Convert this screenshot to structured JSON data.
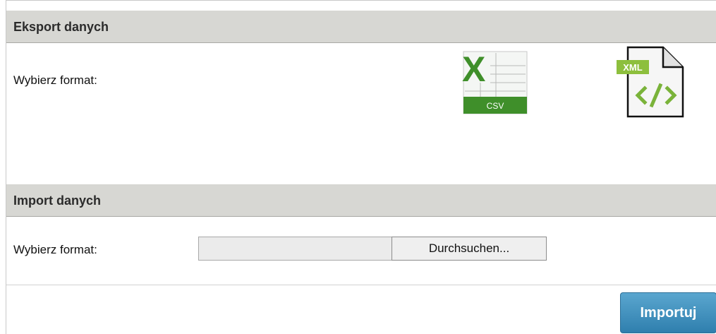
{
  "export": {
    "header": "Eksport danych",
    "label": "Wybierz format:",
    "formats": [
      {
        "name": "CSV",
        "icon": "csv-file-icon",
        "badge": "CSV"
      },
      {
        "name": "XML",
        "icon": "xml-file-icon",
        "badge": "XML"
      }
    ]
  },
  "import": {
    "header": "Import danych",
    "label": "Wybierz format:",
    "file_input": {
      "value": "",
      "browse_label": "Durchsuchen..."
    },
    "submit_label": "Importuj"
  },
  "colors": {
    "header_bg": "#d7d7d3",
    "button_blue": "#3a8cba",
    "excel_green": "#3f8f2a",
    "xml_green": "#7ab33a"
  }
}
